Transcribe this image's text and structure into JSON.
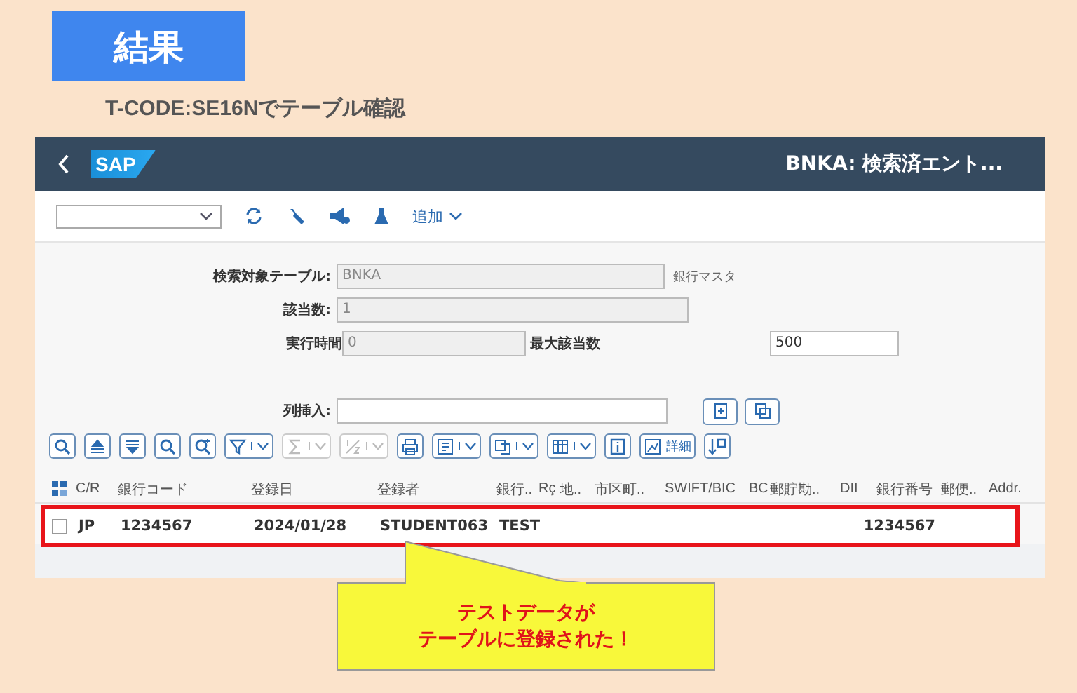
{
  "slide": {
    "heading": "結果",
    "subtitle": "T-CODE:SE16Nでテーブル確認"
  },
  "header": {
    "logo": "SAP",
    "title": "BNKA: 検索済エント..."
  },
  "toolbar": {
    "add_menu": "追加"
  },
  "form": {
    "fields": [
      {
        "label": "検索対象テーブル:",
        "value": "BNKA",
        "disabled": true,
        "note": "銀行マスタ"
      },
      {
        "label": "該当数:",
        "value": "1",
        "disabled": true
      },
      {
        "label": "実行時間",
        "value": "0",
        "disabled": true,
        "extra_label": "最大該当数",
        "extra_value": "500"
      }
    ],
    "column_insert": {
      "label": "列挿入:"
    }
  },
  "alv_tools": [
    {
      "kind": "zoom",
      "menu": false,
      "disabled": false
    },
    {
      "kind": "sort-asc",
      "menu": false,
      "disabled": false
    },
    {
      "kind": "sort-desc",
      "menu": false,
      "disabled": false
    },
    {
      "kind": "find",
      "menu": false,
      "disabled": false
    },
    {
      "kind": "find-next",
      "menu": false,
      "disabled": false
    },
    {
      "kind": "filter",
      "menu": true,
      "disabled": false
    },
    {
      "kind": "sum",
      "menu": true,
      "disabled": true
    },
    {
      "kind": "subtotal",
      "menu": true,
      "disabled": true
    },
    {
      "kind": "print",
      "menu": false,
      "disabled": false
    },
    {
      "kind": "export",
      "menu": true,
      "disabled": false
    },
    {
      "kind": "layout",
      "menu": true,
      "disabled": false
    },
    {
      "kind": "view",
      "menu": true,
      "disabled": false
    },
    {
      "kind": "info",
      "menu": false,
      "disabled": false
    },
    {
      "kind": "detail",
      "menu": false,
      "disabled": false,
      "label": "詳細"
    },
    {
      "kind": "graphic",
      "menu": false,
      "disabled": false
    }
  ],
  "table": {
    "columns": [
      {
        "label": "C/R"
      },
      {
        "label": "銀行コード"
      },
      {
        "label": "登録日"
      },
      {
        "label": "登録者"
      },
      {
        "label": "銀行.."
      },
      {
        "label": "Rç"
      },
      {
        "label": "地.."
      },
      {
        "label": "市区町.."
      },
      {
        "label": "SWIFT/BIC"
      },
      {
        "label": "BC"
      },
      {
        "label": "郵貯勘.."
      },
      {
        "label": "DII"
      },
      {
        "label": "銀行番号"
      },
      {
        "label": "郵便.."
      },
      {
        "label": "Addr."
      }
    ],
    "rows": [
      {
        "selected": false,
        "highlighted": true,
        "cells": [
          "JP",
          "1234567",
          "2024/01/28",
          "STUDENT063",
          "TEST",
          null,
          null,
          null,
          null,
          null,
          null,
          null,
          "1234567",
          null,
          null
        ]
      }
    ]
  },
  "callout": {
    "lines": [
      "テストデータが",
      "テーブルに登録された！"
    ]
  }
}
